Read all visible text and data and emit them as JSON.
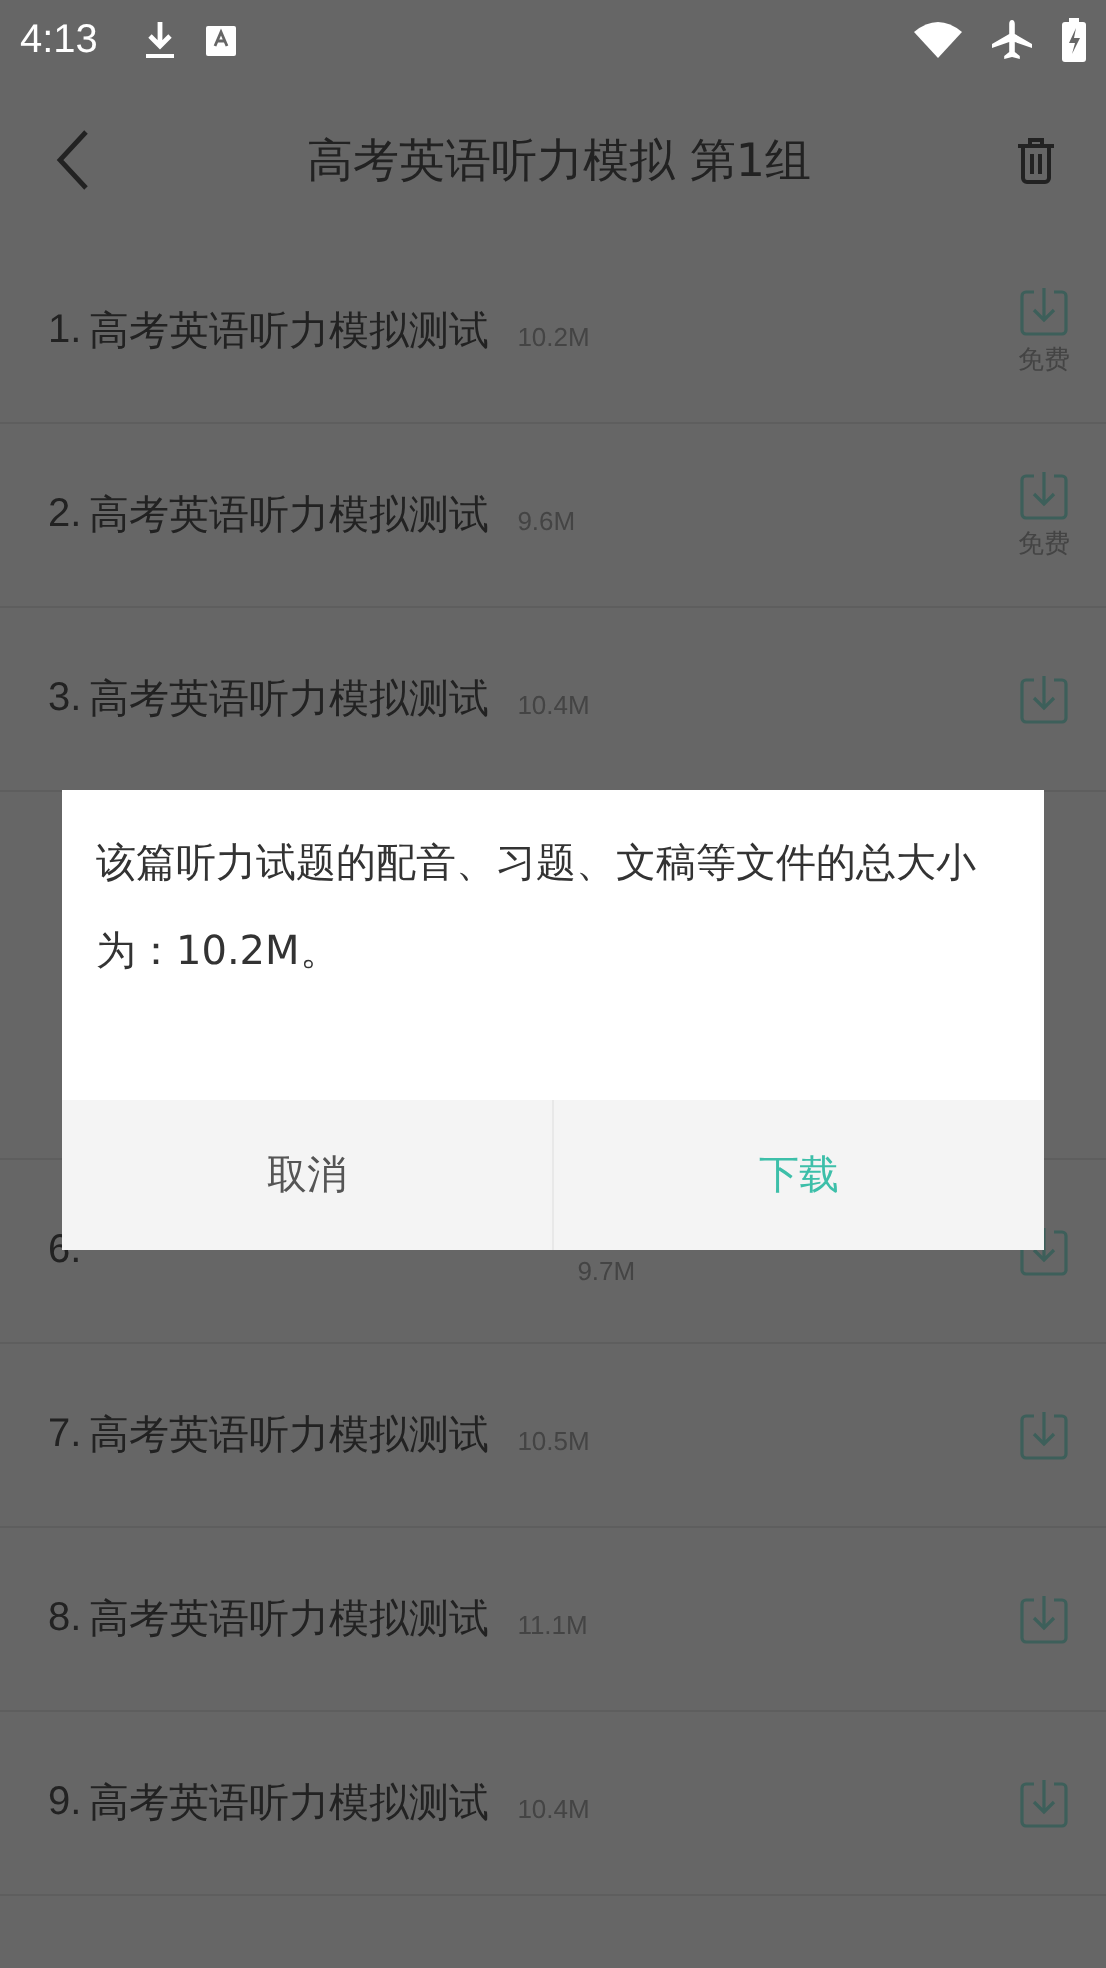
{
  "status_bar": {
    "time": "4:13"
  },
  "header": {
    "title": "高考英语听力模拟 第1组"
  },
  "rows": [
    {
      "number": "1.",
      "title": "高考英语听力模拟测试",
      "size": "10.2M",
      "tag": "免费"
    },
    {
      "number": "2.",
      "title": "高考英语听力模拟测试",
      "size": "9.6M",
      "tag": "免费"
    },
    {
      "number": "3.",
      "title": "高考英语听力模拟测试",
      "size": "10.4M"
    }
  ],
  "rows_below_dialog": [
    {
      "number": "6.",
      "size": "9.7M"
    },
    {
      "number": "7.",
      "title": "高考英语听力模拟测试",
      "size": "10.5M"
    },
    {
      "number": "8.",
      "title": "高考英语听力模拟测试",
      "size": "11.1M"
    },
    {
      "number": "9.",
      "title": "高考英语听力模拟测试",
      "size": "10.4M"
    }
  ],
  "dialog": {
    "message": "该篇听力试题的配音、习题、文稿等文件的总大小为：10.2M。",
    "buttons": [
      {
        "label": "取消",
        "kind": "cancel"
      },
      {
        "label": "下载",
        "kind": "confirm"
      }
    ]
  }
}
